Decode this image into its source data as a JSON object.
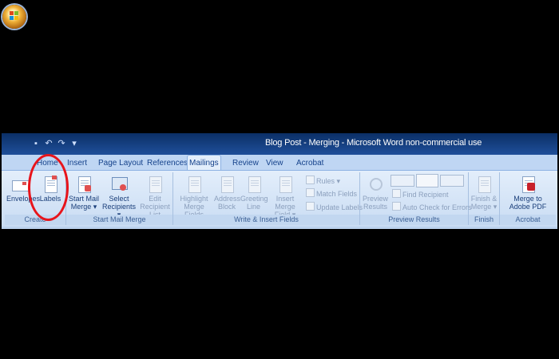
{
  "window": {
    "title": "Blog Post - Merging - Microsoft Word non-commercial use",
    "quick_access": [
      "save-icon",
      "undo-icon",
      "redo-icon",
      "customize-icon"
    ]
  },
  "tabs": [
    "Home",
    "Insert",
    "Page Layout",
    "References",
    "Mailings",
    "Review",
    "View",
    "Acrobat"
  ],
  "active_tab": "Mailings",
  "groups": {
    "create": {
      "label": "Create",
      "envelopes": "Envelopes",
      "labels": "Labels"
    },
    "start_mail_merge": {
      "label": "Start Mail Merge",
      "start": [
        "Start Mail",
        "Merge ▾"
      ],
      "select": [
        "Select",
        "Recipients ▾"
      ],
      "edit": [
        "Edit",
        "Recipient List"
      ]
    },
    "write_insert": {
      "label": "Write & Insert Fields",
      "highlight": [
        "Highlight",
        "Merge Fields"
      ],
      "address": [
        "Address",
        "Block"
      ],
      "greeting": [
        "Greeting",
        "Line"
      ],
      "insert": [
        "Insert Merge",
        "Field ▾"
      ],
      "rules": "Rules ▾",
      "match": "Match Fields",
      "update": "Update Labels"
    },
    "preview": {
      "label": "Preview Results",
      "preview": [
        "Preview",
        "Results"
      ],
      "find": "Find Recipient",
      "auto": "Auto Check for Errors"
    },
    "finish": {
      "label": "Finish",
      "finish": [
        "Finish &",
        "Merge ▾"
      ]
    },
    "acrobat": {
      "label": "Acrobat",
      "merge": [
        "Merge to",
        "Adobe PDF"
      ]
    }
  },
  "annotation_color": "#e8141b"
}
